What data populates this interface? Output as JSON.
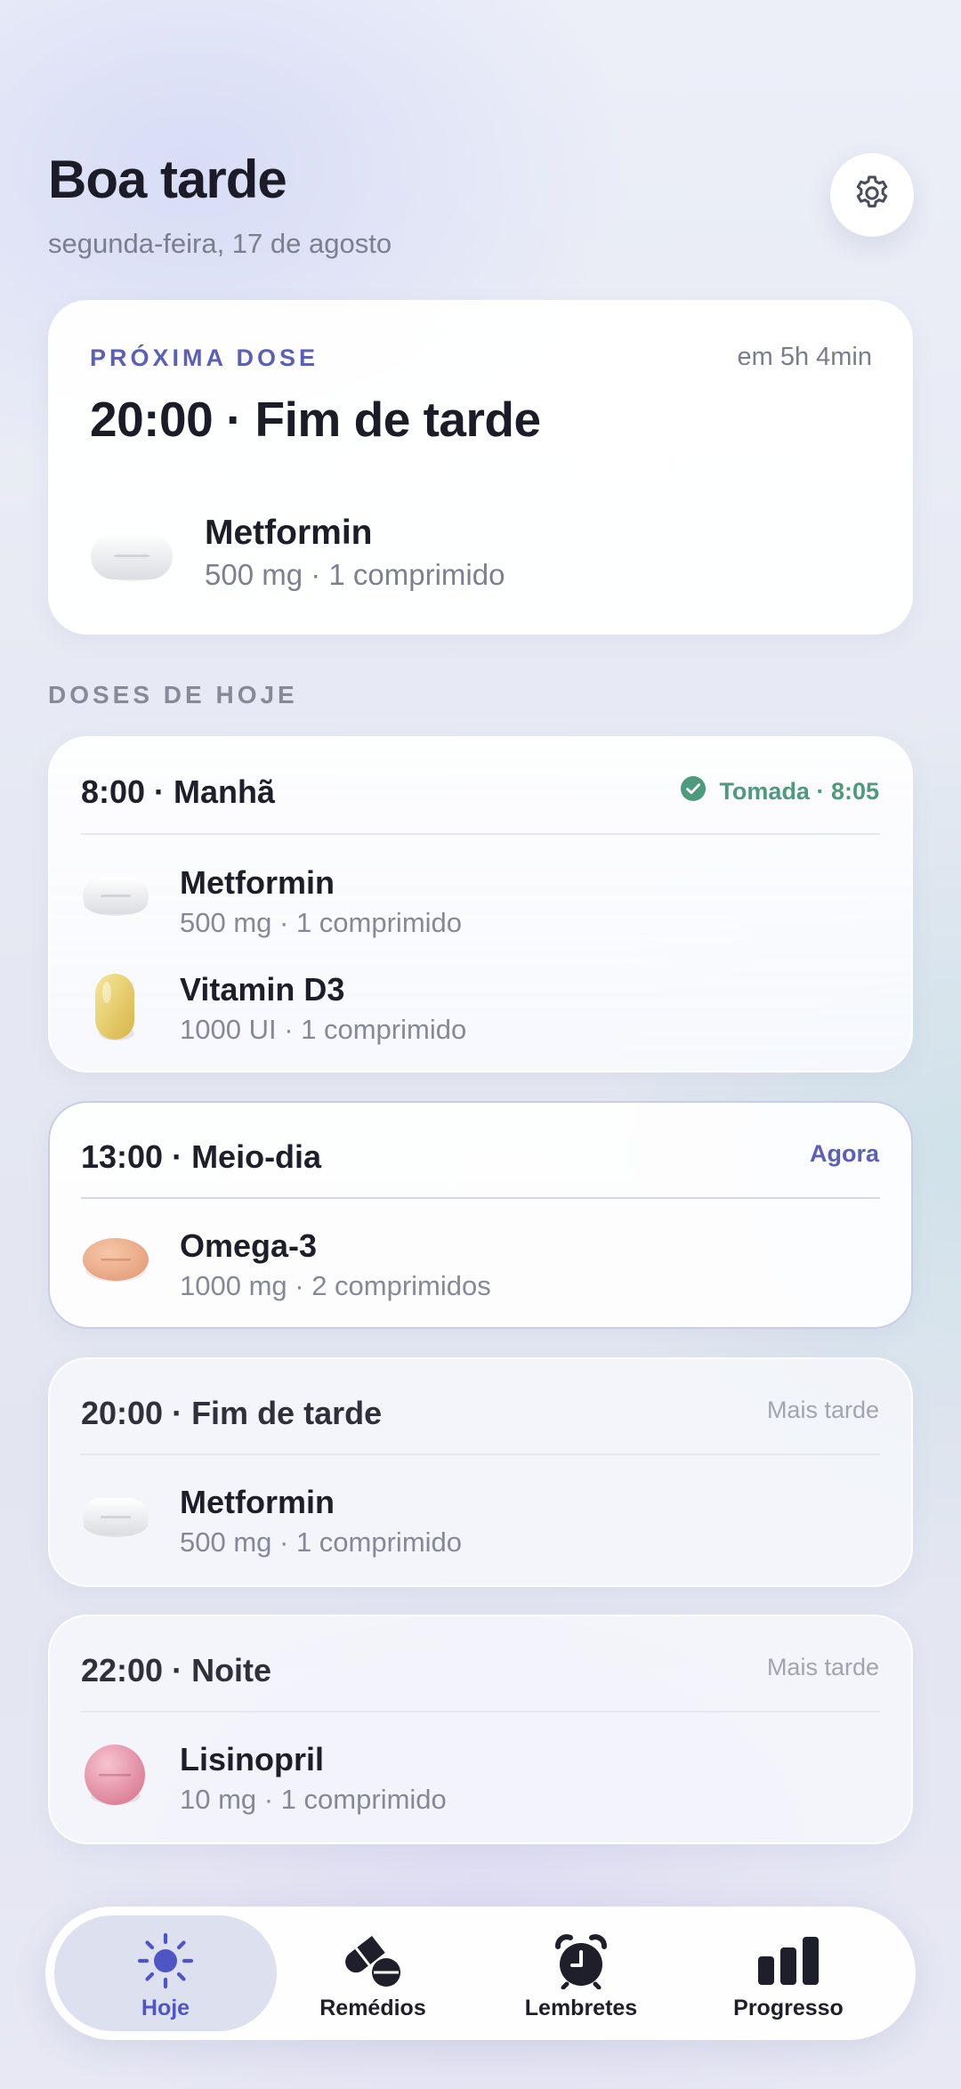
{
  "header": {
    "greeting": "Boa tarde",
    "date": "segunda-feira, 17 de agosto",
    "settings_icon": "gear-icon"
  },
  "next_dose": {
    "label": "PRÓXIMA DOSE",
    "eta": "em 5h 4min",
    "time_title": "20:00 · Fim de tarde",
    "medication": {
      "name": "Metformin",
      "detail": "500 mg · 1 comprimido",
      "pill": "white-oval-pill"
    }
  },
  "section_title": "DOSES DE HOJE",
  "groups": [
    {
      "time": "8:00 · Manhã",
      "status": "Tomada · 8:05",
      "status_kind": "taken",
      "meds": [
        {
          "name": "Metformin",
          "detail": "500 mg · 1 comprimido",
          "pill": "white-oval-pill"
        },
        {
          "name": "Vitamin D3",
          "detail": "1000 UI · 1 comprimido",
          "pill": "yellow-capsule"
        }
      ]
    },
    {
      "time": "13:00 · Meio-dia",
      "status": "Agora",
      "status_kind": "now",
      "meds": [
        {
          "name": "Omega-3",
          "detail": "1000 mg · 2 comprimidos",
          "pill": "orange-oval-pill"
        }
      ]
    },
    {
      "time": "20:00 · Fim de tarde",
      "status": "Mais tarde",
      "status_kind": "later",
      "meds": [
        {
          "name": "Metformin",
          "detail": "500 mg · 1 comprimido",
          "pill": "white-oval-pill"
        }
      ]
    },
    {
      "time": "22:00 · Noite",
      "status": "Mais tarde",
      "status_kind": "later",
      "meds": [
        {
          "name": "Lisinopril",
          "detail": "10 mg · 1 comprimido",
          "pill": "pink-round-pill"
        }
      ]
    }
  ],
  "nav": [
    {
      "label": "Hoje",
      "icon": "sun-icon",
      "active": true
    },
    {
      "label": "Remédios",
      "icon": "pills-icon",
      "active": false
    },
    {
      "label": "Lembretes",
      "icon": "alarm-clock-icon",
      "active": false
    },
    {
      "label": "Progresso",
      "icon": "bar-chart-icon",
      "active": false
    }
  ],
  "colors": {
    "accent": "#5a5fb8",
    "taken": "#4e9a7c",
    "later": "#a2a4ae",
    "text": "#1c1d26"
  }
}
